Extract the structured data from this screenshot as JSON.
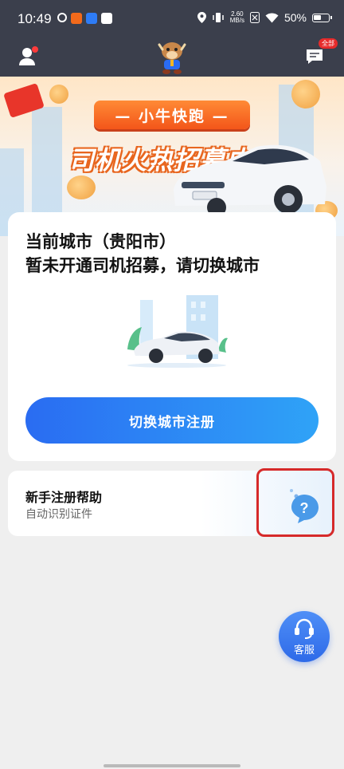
{
  "status_bar": {
    "time": "10:49",
    "net_speed_value": "2.60",
    "net_speed_unit": "MB/s",
    "battery": "50%"
  },
  "header": {
    "message_badge": "全部"
  },
  "banner": {
    "pill_text": "— 小牛快跑 —",
    "headline": "司机火热招募中"
  },
  "city_card": {
    "line1": "当前城市（贵阳市）",
    "line2": "暂未开通司机招募，请切换城市",
    "button_label": "切换城市注册"
  },
  "help_card": {
    "title": "新手注册帮助",
    "subtitle": "自动识别证件"
  },
  "service": {
    "label": "客服"
  },
  "colors": {
    "accent_blue": "#2a6cf2",
    "banner_orange": "#f3561a",
    "highlight_red": "#d62a2a"
  }
}
